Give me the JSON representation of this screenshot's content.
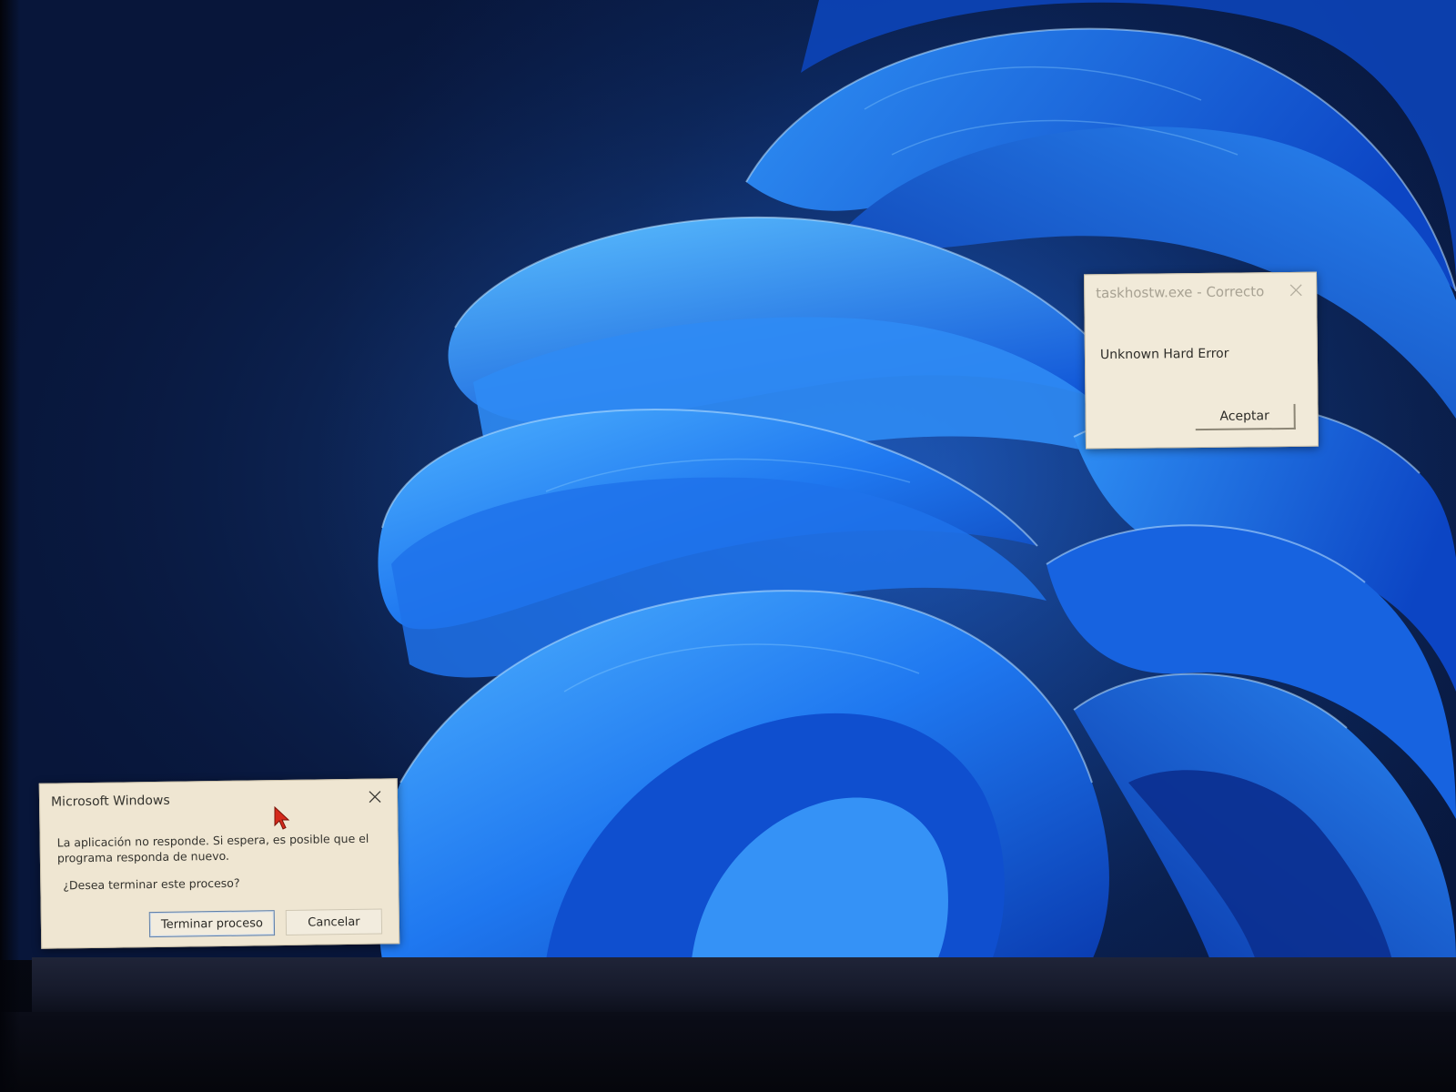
{
  "colors": {
    "wallpaper_base": "#0a1f4d",
    "bloom_light": "#3aa6ff",
    "bloom_mid": "#1f6fe8",
    "bloom_dark": "#0b3fb8",
    "dialog_background": "#efe7d5",
    "cursor": "#d42a1c"
  },
  "error_dialog": {
    "title": "taskhostw.exe - Correcto",
    "message": "Unknown Hard Error",
    "ok_label": "Aceptar",
    "close_icon": "close-icon"
  },
  "hang_dialog": {
    "title": "Microsoft Windows",
    "message": "La aplicación no responde. Si espera, es posible que el programa responda de nuevo.",
    "question": "¿Desea terminar este proceso?",
    "end_process_label": "Terminar proceso",
    "cancel_label": "Cancelar",
    "close_icon": "close-icon"
  },
  "cursor": {
    "icon": "mouse-pointer-icon"
  }
}
